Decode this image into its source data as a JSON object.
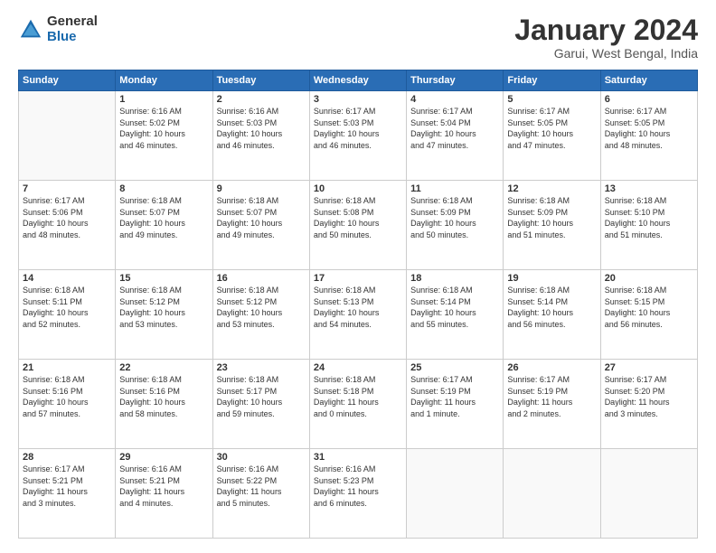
{
  "logo": {
    "general": "General",
    "blue": "Blue"
  },
  "header": {
    "title": "January 2024",
    "subtitle": "Garui, West Bengal, India"
  },
  "weekdays": [
    "Sunday",
    "Monday",
    "Tuesday",
    "Wednesday",
    "Thursday",
    "Friday",
    "Saturday"
  ],
  "weeks": [
    [
      {
        "day": "",
        "info": ""
      },
      {
        "day": "1",
        "info": "Sunrise: 6:16 AM\nSunset: 5:02 PM\nDaylight: 10 hours\nand 46 minutes."
      },
      {
        "day": "2",
        "info": "Sunrise: 6:16 AM\nSunset: 5:03 PM\nDaylight: 10 hours\nand 46 minutes."
      },
      {
        "day": "3",
        "info": "Sunrise: 6:17 AM\nSunset: 5:03 PM\nDaylight: 10 hours\nand 46 minutes."
      },
      {
        "day": "4",
        "info": "Sunrise: 6:17 AM\nSunset: 5:04 PM\nDaylight: 10 hours\nand 47 minutes."
      },
      {
        "day": "5",
        "info": "Sunrise: 6:17 AM\nSunset: 5:05 PM\nDaylight: 10 hours\nand 47 minutes."
      },
      {
        "day": "6",
        "info": "Sunrise: 6:17 AM\nSunset: 5:05 PM\nDaylight: 10 hours\nand 48 minutes."
      }
    ],
    [
      {
        "day": "7",
        "info": "Sunrise: 6:17 AM\nSunset: 5:06 PM\nDaylight: 10 hours\nand 48 minutes."
      },
      {
        "day": "8",
        "info": "Sunrise: 6:18 AM\nSunset: 5:07 PM\nDaylight: 10 hours\nand 49 minutes."
      },
      {
        "day": "9",
        "info": "Sunrise: 6:18 AM\nSunset: 5:07 PM\nDaylight: 10 hours\nand 49 minutes."
      },
      {
        "day": "10",
        "info": "Sunrise: 6:18 AM\nSunset: 5:08 PM\nDaylight: 10 hours\nand 50 minutes."
      },
      {
        "day": "11",
        "info": "Sunrise: 6:18 AM\nSunset: 5:09 PM\nDaylight: 10 hours\nand 50 minutes."
      },
      {
        "day": "12",
        "info": "Sunrise: 6:18 AM\nSunset: 5:09 PM\nDaylight: 10 hours\nand 51 minutes."
      },
      {
        "day": "13",
        "info": "Sunrise: 6:18 AM\nSunset: 5:10 PM\nDaylight: 10 hours\nand 51 minutes."
      }
    ],
    [
      {
        "day": "14",
        "info": "Sunrise: 6:18 AM\nSunset: 5:11 PM\nDaylight: 10 hours\nand 52 minutes."
      },
      {
        "day": "15",
        "info": "Sunrise: 6:18 AM\nSunset: 5:12 PM\nDaylight: 10 hours\nand 53 minutes."
      },
      {
        "day": "16",
        "info": "Sunrise: 6:18 AM\nSunset: 5:12 PM\nDaylight: 10 hours\nand 53 minutes."
      },
      {
        "day": "17",
        "info": "Sunrise: 6:18 AM\nSunset: 5:13 PM\nDaylight: 10 hours\nand 54 minutes."
      },
      {
        "day": "18",
        "info": "Sunrise: 6:18 AM\nSunset: 5:14 PM\nDaylight: 10 hours\nand 55 minutes."
      },
      {
        "day": "19",
        "info": "Sunrise: 6:18 AM\nSunset: 5:14 PM\nDaylight: 10 hours\nand 56 minutes."
      },
      {
        "day": "20",
        "info": "Sunrise: 6:18 AM\nSunset: 5:15 PM\nDaylight: 10 hours\nand 56 minutes."
      }
    ],
    [
      {
        "day": "21",
        "info": "Sunrise: 6:18 AM\nSunset: 5:16 PM\nDaylight: 10 hours\nand 57 minutes."
      },
      {
        "day": "22",
        "info": "Sunrise: 6:18 AM\nSunset: 5:16 PM\nDaylight: 10 hours\nand 58 minutes."
      },
      {
        "day": "23",
        "info": "Sunrise: 6:18 AM\nSunset: 5:17 PM\nDaylight: 10 hours\nand 59 minutes."
      },
      {
        "day": "24",
        "info": "Sunrise: 6:18 AM\nSunset: 5:18 PM\nDaylight: 11 hours\nand 0 minutes."
      },
      {
        "day": "25",
        "info": "Sunrise: 6:17 AM\nSunset: 5:19 PM\nDaylight: 11 hours\nand 1 minute."
      },
      {
        "day": "26",
        "info": "Sunrise: 6:17 AM\nSunset: 5:19 PM\nDaylight: 11 hours\nand 2 minutes."
      },
      {
        "day": "27",
        "info": "Sunrise: 6:17 AM\nSunset: 5:20 PM\nDaylight: 11 hours\nand 3 minutes."
      }
    ],
    [
      {
        "day": "28",
        "info": "Sunrise: 6:17 AM\nSunset: 5:21 PM\nDaylight: 11 hours\nand 3 minutes."
      },
      {
        "day": "29",
        "info": "Sunrise: 6:16 AM\nSunset: 5:21 PM\nDaylight: 11 hours\nand 4 minutes."
      },
      {
        "day": "30",
        "info": "Sunrise: 6:16 AM\nSunset: 5:22 PM\nDaylight: 11 hours\nand 5 minutes."
      },
      {
        "day": "31",
        "info": "Sunrise: 6:16 AM\nSunset: 5:23 PM\nDaylight: 11 hours\nand 6 minutes."
      },
      {
        "day": "",
        "info": ""
      },
      {
        "day": "",
        "info": ""
      },
      {
        "day": "",
        "info": ""
      }
    ]
  ]
}
